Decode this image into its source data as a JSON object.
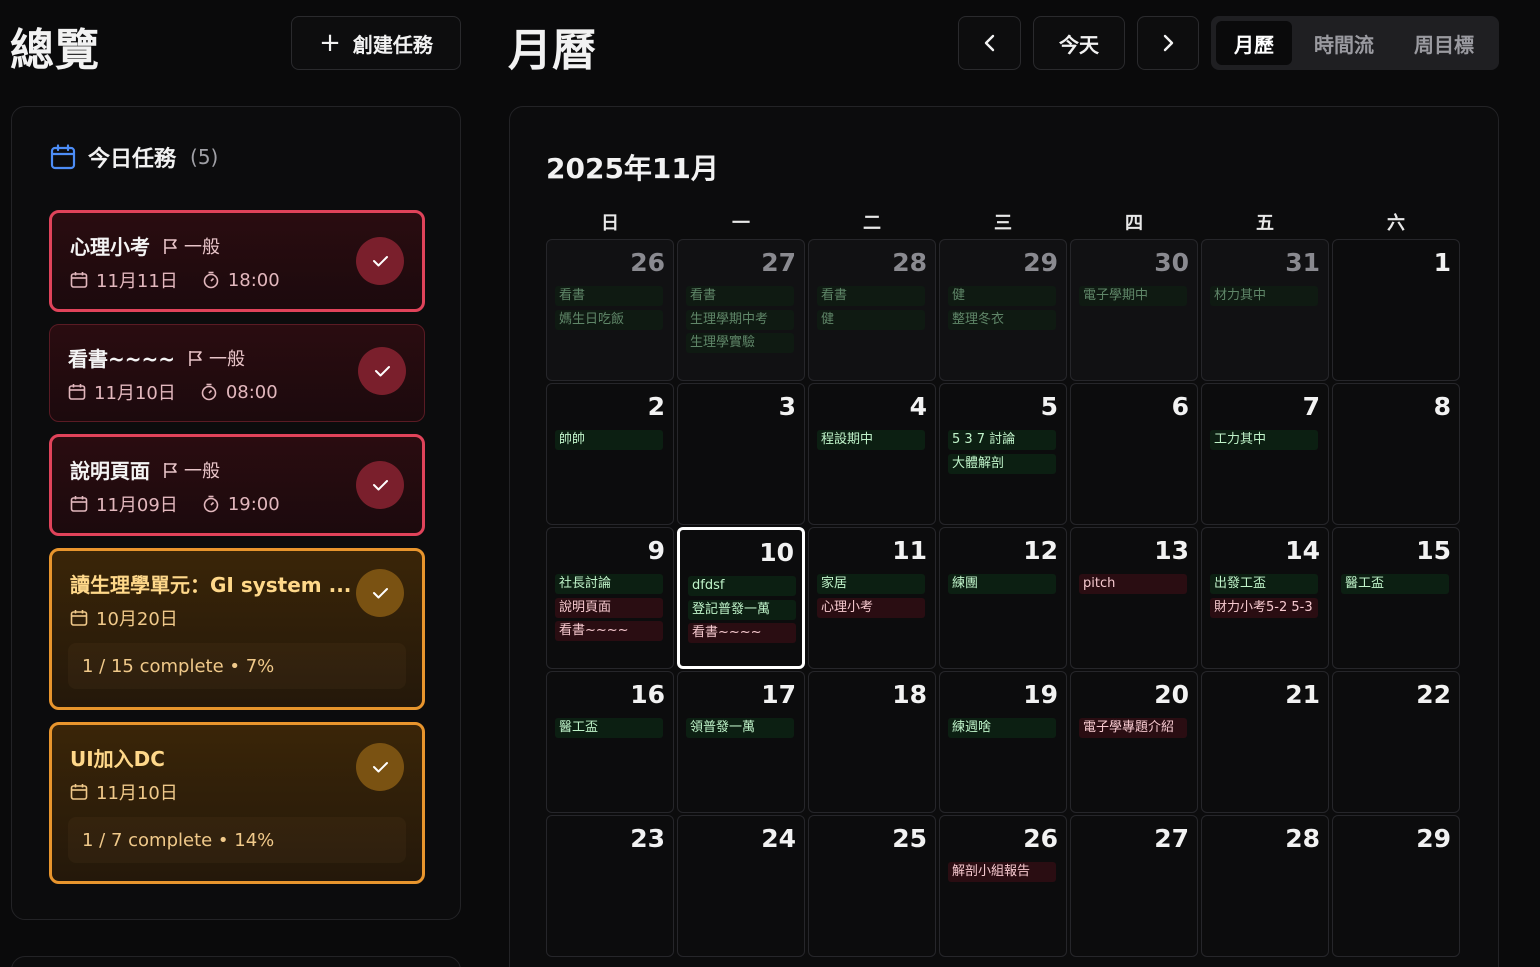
{
  "header": {
    "overview_title": "總覽",
    "create_task_label": "創建任務",
    "calendar_title": "月曆",
    "today_label": "今天",
    "views": [
      "月歷",
      "時間流",
      "周目標"
    ]
  },
  "today_tasks": {
    "title": "今日任務",
    "count_text": "(5)",
    "items": [
      {
        "title": "心理小考",
        "priority": "一般",
        "date": "11月11日",
        "time": "18:00",
        "style": "red"
      },
      {
        "title": "看書~~~~",
        "priority": "一般",
        "date": "11月10日",
        "time": "08:00",
        "style": "red-dim"
      },
      {
        "title": "說明頁面",
        "priority": "一般",
        "date": "11月09日",
        "time": "19:00",
        "style": "red"
      },
      {
        "title": "讀生理學單元：GI system ...",
        "date": "10月20日",
        "progress": "1 / 15 complete • 7%",
        "style": "amber"
      },
      {
        "title": "UI加入DC",
        "date": "11月10日",
        "progress": "1 / 7 complete • 14%",
        "style": "amber"
      }
    ]
  },
  "calendar": {
    "month_label": "2025年11月",
    "weekdays": [
      "日",
      "一",
      "二",
      "三",
      "四",
      "五",
      "六"
    ],
    "weeks": [
      [
        {
          "n": "26",
          "outside": true,
          "events": [
            {
              "t": "看書",
              "c": "g"
            },
            {
              "t": "媽生日吃飯",
              "c": "g"
            }
          ]
        },
        {
          "n": "27",
          "outside": true,
          "events": [
            {
              "t": "看書",
              "c": "g"
            },
            {
              "t": "生理學期中考",
              "c": "g"
            },
            {
              "t": "生理學實驗",
              "c": "g"
            }
          ]
        },
        {
          "n": "28",
          "outside": true,
          "events": [
            {
              "t": "看書",
              "c": "g"
            },
            {
              "t": "健",
              "c": "g"
            }
          ]
        },
        {
          "n": "29",
          "outside": true,
          "events": [
            {
              "t": "健",
              "c": "g"
            },
            {
              "t": "整理冬衣",
              "c": "g"
            }
          ]
        },
        {
          "n": "30",
          "outside": true,
          "events": [
            {
              "t": "電子學期中",
              "c": "g"
            }
          ]
        },
        {
          "n": "31",
          "outside": true,
          "events": [
            {
              "t": "材力其中",
              "c": "g"
            }
          ]
        },
        {
          "n": "1",
          "outside": false,
          "events": []
        }
      ],
      [
        {
          "n": "2",
          "events": [
            {
              "t": "帥帥",
              "c": "g"
            }
          ]
        },
        {
          "n": "3",
          "events": []
        },
        {
          "n": "4",
          "events": [
            {
              "t": "程設期中",
              "c": "g"
            }
          ]
        },
        {
          "n": "5",
          "events": [
            {
              "t": "5 3 7 討論",
              "c": "g"
            },
            {
              "t": "大體解剖",
              "c": "g"
            }
          ]
        },
        {
          "n": "6",
          "events": []
        },
        {
          "n": "7",
          "events": [
            {
              "t": "工力其中",
              "c": "g"
            }
          ]
        },
        {
          "n": "8",
          "events": []
        }
      ],
      [
        {
          "n": "9",
          "events": [
            {
              "t": "社長討論",
              "c": "g"
            },
            {
              "t": "說明頁面",
              "c": "r"
            },
            {
              "t": "看書~~~~",
              "c": "r"
            }
          ]
        },
        {
          "n": "10",
          "today": true,
          "events": [
            {
              "t": "dfdsf",
              "c": "g"
            },
            {
              "t": "登記普發一萬",
              "c": "g"
            },
            {
              "t": "看書~~~~",
              "c": "r"
            }
          ]
        },
        {
          "n": "11",
          "events": [
            {
              "t": "家居",
              "c": "g"
            },
            {
              "t": "心理小考",
              "c": "r"
            }
          ]
        },
        {
          "n": "12",
          "events": [
            {
              "t": "練團",
              "c": "g"
            }
          ]
        },
        {
          "n": "13",
          "events": [
            {
              "t": "pitch",
              "c": "r"
            }
          ]
        },
        {
          "n": "14",
          "events": [
            {
              "t": "出發工盃",
              "c": "g"
            },
            {
              "t": "財力小考5-2 5-3",
              "c": "r"
            }
          ]
        },
        {
          "n": "15",
          "events": [
            {
              "t": "醫工盃",
              "c": "g"
            }
          ]
        }
      ],
      [
        {
          "n": "16",
          "events": [
            {
              "t": "醫工盃",
              "c": "g"
            }
          ]
        },
        {
          "n": "17",
          "events": [
            {
              "t": "領普發一萬",
              "c": "g"
            }
          ]
        },
        {
          "n": "18",
          "events": []
        },
        {
          "n": "19",
          "events": [
            {
              "t": "練週啥",
              "c": "g"
            }
          ]
        },
        {
          "n": "20",
          "events": [
            {
              "t": "電子學專題介紹",
              "c": "r"
            }
          ]
        },
        {
          "n": "21",
          "events": []
        },
        {
          "n": "22",
          "events": []
        }
      ],
      [
        {
          "n": "23",
          "events": []
        },
        {
          "n": "24",
          "events": []
        },
        {
          "n": "25",
          "events": []
        },
        {
          "n": "26",
          "events": [
            {
              "t": "解剖小組報告",
              "c": "r"
            }
          ]
        },
        {
          "n": "27",
          "events": []
        },
        {
          "n": "28",
          "events": []
        },
        {
          "n": "29",
          "events": []
        }
      ]
    ]
  },
  "colors": {
    "accent_red": "#e0435a",
    "accent_amber": "#e8952d",
    "event_green_bg": "#0c1f12",
    "event_red_bg": "#2a0d12"
  },
  "icons": [
    "plus-icon",
    "calendar-icon",
    "flag-icon",
    "timer-icon",
    "check-icon",
    "chevron-left-icon",
    "chevron-right-icon"
  ]
}
